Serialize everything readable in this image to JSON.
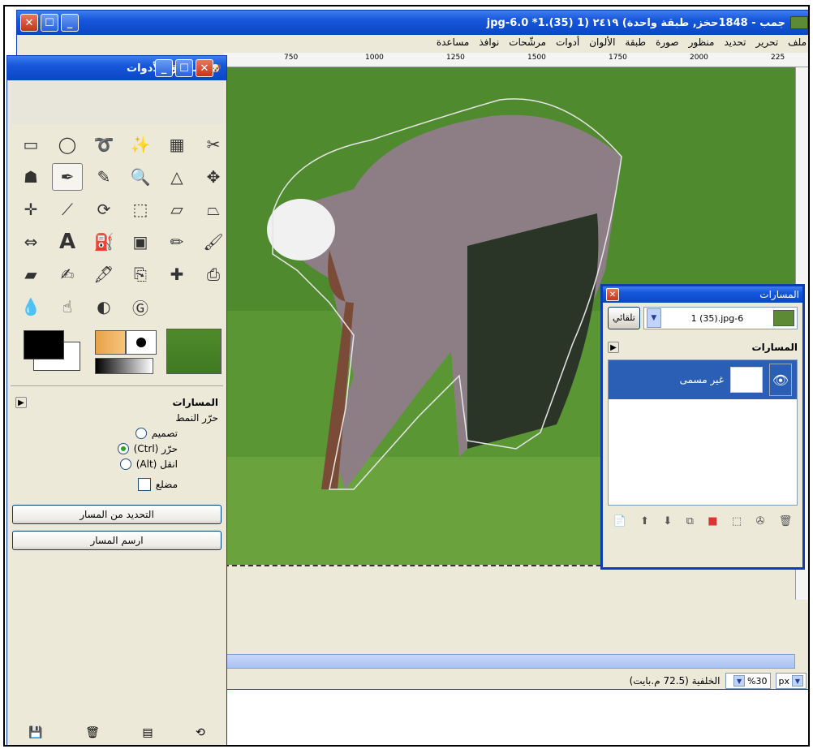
{
  "main_window": {
    "title": "جمب - 1848حخز, طبقة واحدة) ٢٤١٩ (1 (35).jpg-6.0 *1",
    "menu": [
      "ملف",
      "تحرير",
      "تحديد",
      "منظور",
      "صورة",
      "طبقة",
      "الألوان",
      "أدوات",
      "مرشّحات",
      "نوافذ",
      "مساعدة"
    ],
    "ruler_labels": [
      "750",
      "1000",
      "1250",
      "1500",
      "1750",
      "2000",
      "225"
    ],
    "status": {
      "zoom": "%30",
      "unit": "px",
      "text": "الخلفية (72.5 م.بايت)"
    }
  },
  "toolbox": {
    "title": "صندوق الأدوات",
    "options_title": "المسارات",
    "mode_label": "حرّر النمط",
    "modes": [
      {
        "label": "تصميم",
        "selected": false
      },
      {
        "label": "حرّر (Ctrl)",
        "selected": true
      },
      {
        "label": "انقل (Alt)",
        "selected": false
      }
    ],
    "polygon_label": "مضلع",
    "btn_selection": "التحديد من المسار",
    "btn_stroke": "ارسم المسار"
  },
  "paths_dialog": {
    "title": "المسارات",
    "auto_label": "تلقائي",
    "image_name": "1 (35).jpg-6",
    "section_title": "المسارات",
    "path_name": "غير مسمى"
  },
  "colors": {
    "accent": "#0a47c6",
    "selection": "#2a5fb5"
  }
}
